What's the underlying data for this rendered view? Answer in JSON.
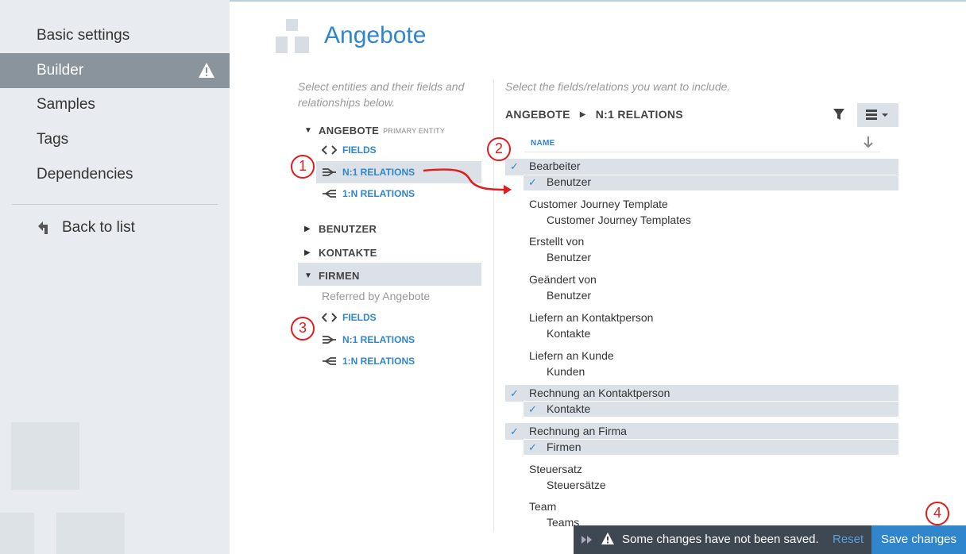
{
  "sidebar": {
    "items": [
      {
        "label": "Basic settings"
      },
      {
        "label": "Builder"
      },
      {
        "label": "Samples"
      },
      {
        "label": "Tags"
      },
      {
        "label": "Dependencies"
      }
    ],
    "back_label": "Back to list"
  },
  "page": {
    "title": "Angebote"
  },
  "left": {
    "hint": "Select entities and their fields and relationships below.",
    "primary": {
      "name": "ANGEBOTE",
      "tag": "PRIMARY ENTITY"
    },
    "primary_links": [
      "FIELDS",
      "N:1 RELATIONS",
      "1:N RELATIONS"
    ],
    "entities": [
      "BENUTZER",
      "KONTAKTE",
      "FIRMEN"
    ],
    "referred": "Referred by Angebote",
    "firmen_links": [
      "FIELDS",
      "N:1 RELATIONS",
      "1:N RELATIONS"
    ]
  },
  "right": {
    "hint": "Select the fields/relations you want to include.",
    "crumb": [
      "ANGEBOTE",
      "N:1 RELATIONS"
    ],
    "col_name": "NAME",
    "rows": [
      {
        "name": "Bearbeiter",
        "sub": "Benutzer",
        "checked": true
      },
      {
        "name": "Customer Journey Template",
        "sub": "Customer Journey Templates",
        "checked": false
      },
      {
        "name": "Erstellt von",
        "sub": "Benutzer",
        "checked": false
      },
      {
        "name": "Geändert von",
        "sub": "Benutzer",
        "checked": false
      },
      {
        "name": "Liefern an Kontaktperson",
        "sub": "Kontakte",
        "checked": false
      },
      {
        "name": "Liefern an Kunde",
        "sub": "Kunden",
        "checked": false
      },
      {
        "name": "Rechnung an Kontaktperson",
        "sub": "Kontakte",
        "checked": true
      },
      {
        "name": "Rechnung an Firma",
        "sub": "Firmen",
        "checked": true
      },
      {
        "name": "Steuersatz",
        "sub": "Steuersätze",
        "checked": false
      },
      {
        "name": "Team",
        "sub": "Teams",
        "checked": false
      }
    ]
  },
  "annotations": [
    "1",
    "2",
    "3",
    "4"
  ],
  "bar": {
    "message": "Some changes have not been saved.",
    "reset": "Reset",
    "save": "Save changes"
  },
  "colors": {
    "accent": "#2f86cc",
    "annotation": "#e31b1b",
    "bar": "#3d4852",
    "highlight": "#dbe1e6"
  }
}
